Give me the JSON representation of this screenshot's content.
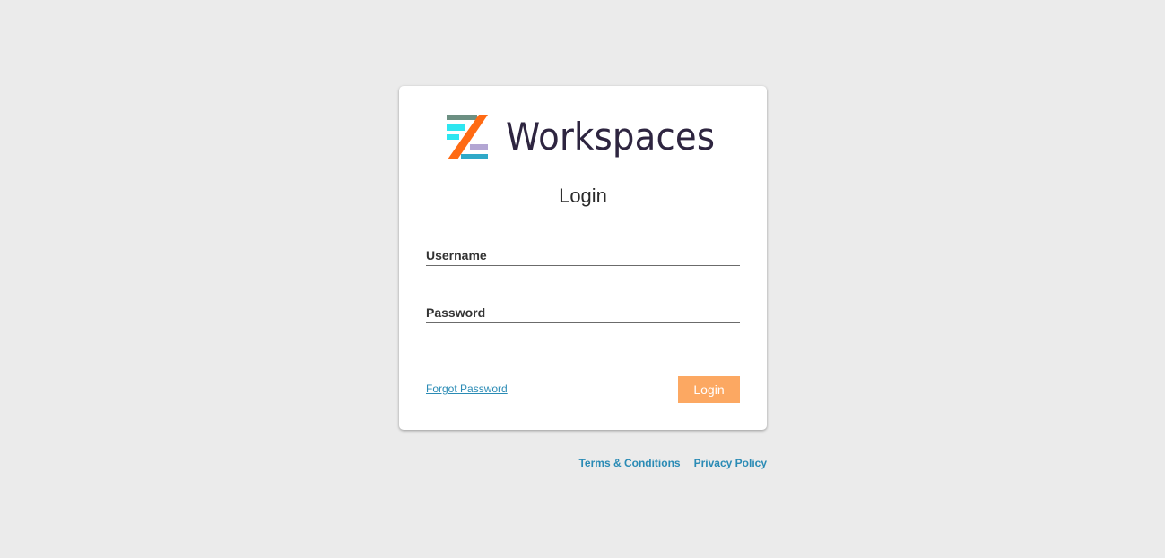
{
  "brand": {
    "name": "Workspaces",
    "logo_icon": "workspaces-z-logo",
    "colors": {
      "orange": "#ff6a13",
      "cyan": "#2ee6f0",
      "teal": "#2fa9c8",
      "gray_green": "#6c8f82",
      "lavender": "#b3a6d3",
      "text": "#2e2540"
    }
  },
  "login_form": {
    "heading": "Login",
    "username_label": "Username",
    "username_value": "",
    "password_label": "Password",
    "password_value": "",
    "forgot_password_label": "Forgot Password",
    "submit_label": "Login",
    "submit_color": "#fca862",
    "link_color": "#2a8bb5"
  },
  "footer": {
    "terms_label": "Terms & Conditions",
    "privacy_label": "Privacy Policy"
  }
}
